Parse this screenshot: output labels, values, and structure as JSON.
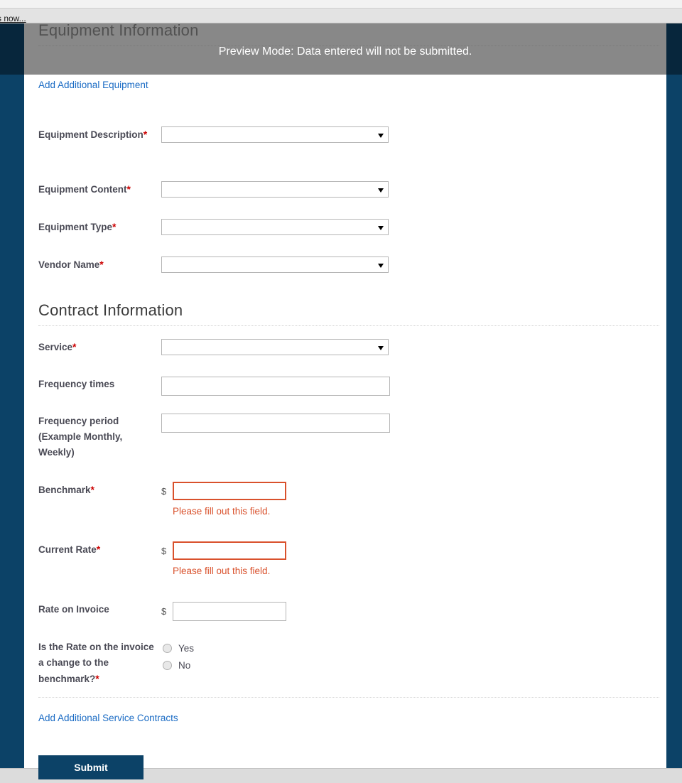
{
  "browser": {
    "tab_remnant_text": "s now..."
  },
  "overlay": {
    "preview_banner": "Preview Mode: Data entered will not be submitted."
  },
  "colors": {
    "rail_navy": "#0c4267",
    "rail_navy_dark": "#07263c",
    "link_blue": "#1a6bc4",
    "required_red": "#cc0000",
    "error_orange": "#d9512c",
    "label_gray": "#4a4a55",
    "heading_gray": "#3a3a3a",
    "overlay_gray": "rgba(90,90,90,0.72)",
    "bottom_strip": "#dcdcdc"
  },
  "sections": {
    "equipment": {
      "heading": "Equipment Information",
      "add_link": "Add Additional Equipment",
      "fields": [
        {
          "label": "Equipment Description",
          "required": true,
          "type": "select",
          "value": ""
        },
        {
          "label": "Equipment Content",
          "required": true,
          "type": "select",
          "value": ""
        },
        {
          "label": "Equipment Type",
          "required": true,
          "type": "select",
          "value": ""
        },
        {
          "label": "Vendor Name",
          "required": true,
          "type": "select",
          "value": ""
        }
      ]
    },
    "contract": {
      "heading": "Contract Information",
      "add_link": "Add Additional Service Contracts",
      "fields": [
        {
          "label": "Service",
          "required": true,
          "type": "select",
          "value": ""
        },
        {
          "label": "Frequency times",
          "required": false,
          "type": "text",
          "value": ""
        },
        {
          "label": "Frequency period (Example Monthly, Weekly)",
          "required": false,
          "type": "text",
          "value": ""
        },
        {
          "label": "Benchmark",
          "required": true,
          "type": "money",
          "prefix": "$",
          "value": "",
          "error": "Please fill out this field."
        },
        {
          "label": "Current Rate",
          "required": true,
          "type": "money",
          "prefix": "$",
          "value": "",
          "error": "Please fill out this field."
        },
        {
          "label": "Rate on Invoice",
          "required": false,
          "type": "money",
          "prefix": "$",
          "value": ""
        },
        {
          "label": "Is the Rate on the invoice a change to the benchmark?",
          "required": true,
          "type": "radio",
          "options": [
            {
              "label": "Yes",
              "checked": false
            },
            {
              "label": "No",
              "checked": false
            }
          ]
        }
      ]
    }
  },
  "footer": {
    "submit_label": "Submit"
  }
}
